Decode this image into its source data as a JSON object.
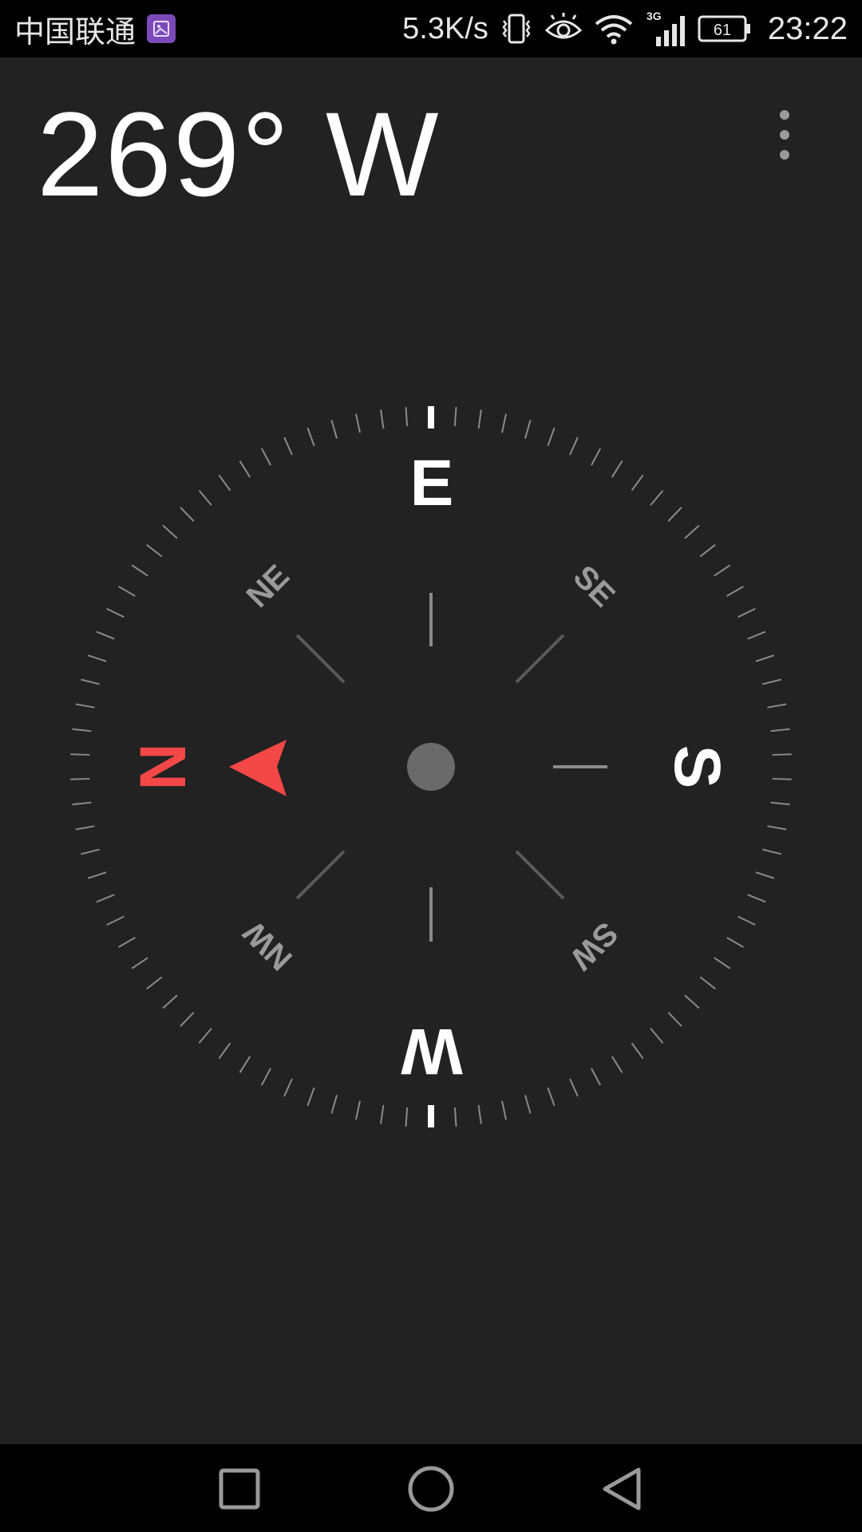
{
  "status_bar": {
    "carrier": "中国联通",
    "net_speed": "5.3K/s",
    "network_type": "3G",
    "battery": "61",
    "time": "23:22",
    "icons": [
      "gallery-icon",
      "vibrate-icon",
      "eye-icon",
      "wifi-icon",
      "signal-icon",
      "battery-icon"
    ]
  },
  "header": {
    "heading": "269° W"
  },
  "compass": {
    "labels": {
      "N": "N",
      "E": "E",
      "S": "S",
      "W": "W",
      "NE": "NE",
      "SE": "SE",
      "SW": "SW",
      "NW": "NW"
    },
    "north_color": "#f44747",
    "needle_color": "#f44747",
    "major_tick_color": "#ffffff",
    "minor_tick_color": "#8a8a8a",
    "center_color": "#6a6a6a"
  },
  "nav_bar": {
    "buttons": [
      "recents-button",
      "home-button",
      "back-button"
    ]
  }
}
